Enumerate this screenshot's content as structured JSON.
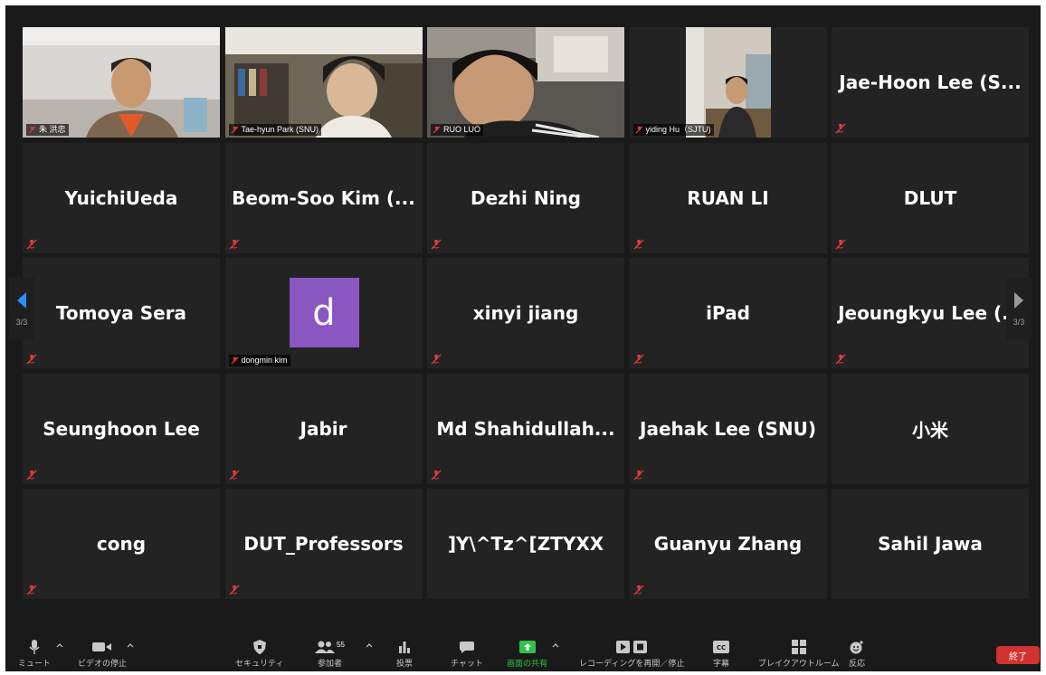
{
  "nav": {
    "left_page": "3/3",
    "right_page": "3/3"
  },
  "tiles": [
    {
      "kind": "video",
      "label": "朱 洪忠"
    },
    {
      "kind": "video",
      "label": "Tae-hyun Park (SNU)"
    },
    {
      "kind": "video",
      "label": "RUO LUO"
    },
    {
      "kind": "video",
      "label": "yiding Hu（SJTU)"
    },
    {
      "kind": "name",
      "name": "Jae-Hoon Lee (S..."
    },
    {
      "kind": "name",
      "name": "YuichiUeda"
    },
    {
      "kind": "name",
      "name": "Beom-Soo Kim (..."
    },
    {
      "kind": "name",
      "name": "Dezhi Ning"
    },
    {
      "kind": "name",
      "name": "RUAN LI"
    },
    {
      "kind": "name",
      "name": "DLUT"
    },
    {
      "kind": "name",
      "name": "Tomoya Sera"
    },
    {
      "kind": "avatar",
      "initial": "d",
      "label": "dongmin kim"
    },
    {
      "kind": "name",
      "name": "xinyi jiang"
    },
    {
      "kind": "name",
      "name": "iPad"
    },
    {
      "kind": "name",
      "name": "Jeoungkyu Lee (..."
    },
    {
      "kind": "name",
      "name": "Seunghoon Lee"
    },
    {
      "kind": "name",
      "name": "Jabir"
    },
    {
      "kind": "name",
      "name": "Md  Shahidullah..."
    },
    {
      "kind": "name",
      "name": "Jaehak Lee (SNU)"
    },
    {
      "kind": "name",
      "name": "小米"
    },
    {
      "kind": "name",
      "name": "cong"
    },
    {
      "kind": "name",
      "name": "DUT_Professors"
    },
    {
      "kind": "name",
      "name": "]Y\\^Tz^[ZTYXX"
    },
    {
      "kind": "name",
      "name": "Guanyu Zhang"
    },
    {
      "kind": "name",
      "name": "Sahil Jawa"
    }
  ],
  "toolbar": {
    "mute": "ミュート",
    "stop_video": "ビデオの停止",
    "security": "セキュリティ",
    "participants": "参加者",
    "participants_count": "55",
    "polls": "投票",
    "chat": "チャット",
    "share_screen": "画面の共有",
    "recording": "レコーディングを再開／停止",
    "captions": "字幕",
    "breakout": "ブレイクアウトルーム",
    "reactions": "反応",
    "end": "終了"
  },
  "colors": {
    "background": "#1a1a1a",
    "tile": "#232323",
    "avatar": "#8a56c2",
    "muted_icon": "#e03a3a",
    "share_green": "#2fc24a",
    "end_red": "#d13330",
    "nav_arrow": "#2d8cff"
  }
}
